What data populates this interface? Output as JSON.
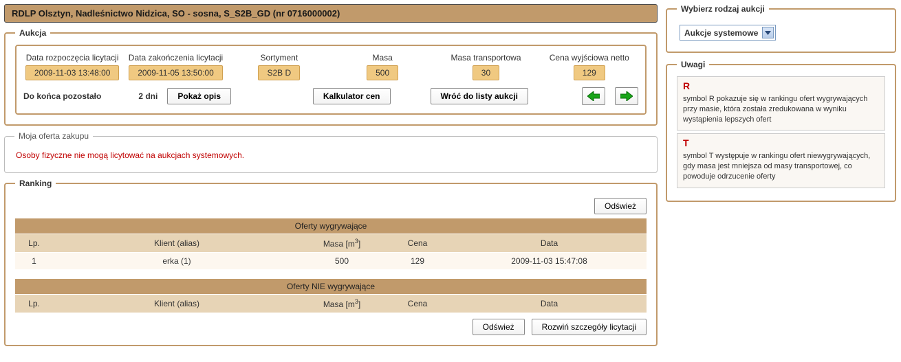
{
  "titlebar": "RDLP  Olsztyn, Nadleśnictwo Nidzica, SO - sosna, S_S2B_GD (nr 0716000002)",
  "aukcja": {
    "legend": "Aukcja",
    "fields": {
      "start_label": "Data rozpoczęcia licytacji",
      "start_value": "2009-11-03 13:48:00",
      "end_label": "Data zakończenia licytacji",
      "end_value": "2009-11-05 13:50:00",
      "sortyment_label": "Sortyment",
      "sortyment_value": "S2B D",
      "masa_label": "Masa",
      "masa_value": "500",
      "masa_transport_label": "Masa transportowa",
      "masa_transport_value": "30",
      "cena_label": "Cena wyjściowa netto",
      "cena_value": "129"
    },
    "remaining_label": "Do końca pozostało",
    "remaining_value": "2 dni",
    "btn_opis": "Pokaż opis",
    "btn_kalkulator": "Kalkulator cen",
    "btn_wroc": "Wróć do listy aukcji"
  },
  "moja_oferta": {
    "legend": "Moja oferta zakupu",
    "message": "Osoby fizyczne nie mogą licytować na aukcjach systemowych."
  },
  "ranking": {
    "legend": "Ranking",
    "btn_refresh": "Odśwież",
    "btn_expand": "Rozwiń szczegóły licytacji",
    "winning": {
      "caption": "Oferty wygrywające",
      "cols": {
        "lp": "Lp.",
        "klient": "Klient (alias)",
        "masa": "Masa [m",
        "masa_sup": "3",
        "masa_close": "]",
        "cena": "Cena",
        "data": "Data"
      },
      "rows": [
        {
          "lp": "1",
          "klient": "erka (1)",
          "masa": "500",
          "cena": "129",
          "data": "2009-11-03 15:47:08"
        }
      ]
    },
    "losing": {
      "caption": "Oferty NIE wygrywające",
      "cols": {
        "lp": "Lp.",
        "klient": "Klient (alias)",
        "masa": "Masa [m",
        "masa_sup": "3",
        "masa_close": "]",
        "cena": "Cena",
        "data": "Data"
      },
      "rows": []
    }
  },
  "right": {
    "select_legend": "Wybierz rodzaj aukcji",
    "select_value": "Aukcje systemowe",
    "uwagi_legend": "Uwagi",
    "uwagi": [
      {
        "sym": "R",
        "text": "symbol R pokazuje się w rankingu ofert wygrywających przy masie, która została zredukowana w wyniku wystąpienia lepszych ofert"
      },
      {
        "sym": "T",
        "text": "symbol T występuje w rankingu ofert niewygrywających, gdy masa jest mniejsza od masy transportowej, co powoduje odrzucenie oferty"
      }
    ]
  }
}
